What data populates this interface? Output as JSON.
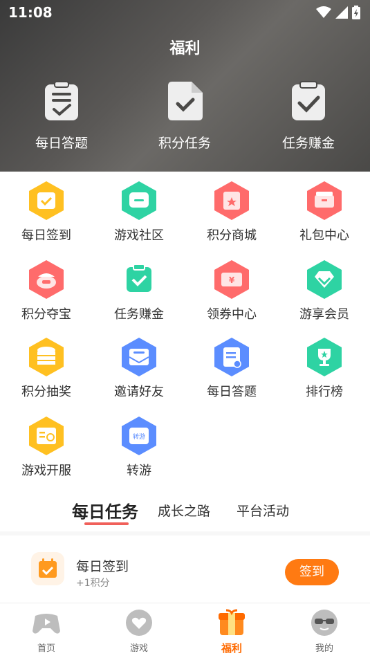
{
  "status_bar": {
    "time": "11:08"
  },
  "header": {
    "title": "福利"
  },
  "top_items": [
    {
      "label": "每日答题",
      "icon": "clipboard-answer-icon"
    },
    {
      "label": "积分任务",
      "icon": "document-check-icon"
    },
    {
      "label": "任务赚金",
      "icon": "clipboard-check-icon"
    }
  ],
  "grid": [
    {
      "label": "每日签到",
      "icon": "calendar-check-icon",
      "color": "#ffc021"
    },
    {
      "label": "游戏社区",
      "icon": "chat-icon",
      "color": "#2ed3a3"
    },
    {
      "label": "积分商城",
      "icon": "shop-icon",
      "color": "#ff6b6b"
    },
    {
      "label": "礼包中心",
      "icon": "gift-icon",
      "color": "#ff6b6b"
    },
    {
      "label": "积分夺宝",
      "icon": "treasure-icon",
      "color": "#ff6b6b"
    },
    {
      "label": "任务赚金",
      "icon": "task-check-icon",
      "color": "#2ed3a3"
    },
    {
      "label": "领券中心",
      "icon": "coupon-icon",
      "color": "#ff6b6b"
    },
    {
      "label": "游享会员",
      "icon": "diamond-icon",
      "color": "#2ed3a3"
    },
    {
      "label": "积分抽奖",
      "icon": "coins-icon",
      "color": "#ffc021"
    },
    {
      "label": "邀请好友",
      "icon": "mail-icon",
      "color": "#5b8dff"
    },
    {
      "label": "每日答题",
      "icon": "quiz-icon",
      "color": "#5b8dff"
    },
    {
      "label": "排行榜",
      "icon": "trophy-icon",
      "color": "#2ed3a3"
    },
    {
      "label": "游戏开服",
      "icon": "server-open-icon",
      "color": "#ffc021"
    },
    {
      "label": "转游",
      "icon": "transfer-icon",
      "color": "#5b8dff",
      "badge_text": "转游"
    }
  ],
  "tabs": [
    {
      "label": "每日任务",
      "active": true
    },
    {
      "label": "成长之路",
      "active": false
    },
    {
      "label": "平台活动",
      "active": false
    }
  ],
  "task": {
    "title": "每日签到",
    "subtitle": "+1积分",
    "button": "签到"
  },
  "bottom_nav": [
    {
      "label": "首页",
      "icon": "gamepad-icon",
      "active": false
    },
    {
      "label": "游戏",
      "icon": "heart-chat-icon",
      "active": false
    },
    {
      "label": "福利",
      "icon": "gift-box-icon",
      "active": true
    },
    {
      "label": "我的",
      "icon": "sunglasses-face-icon",
      "active": false
    }
  ]
}
